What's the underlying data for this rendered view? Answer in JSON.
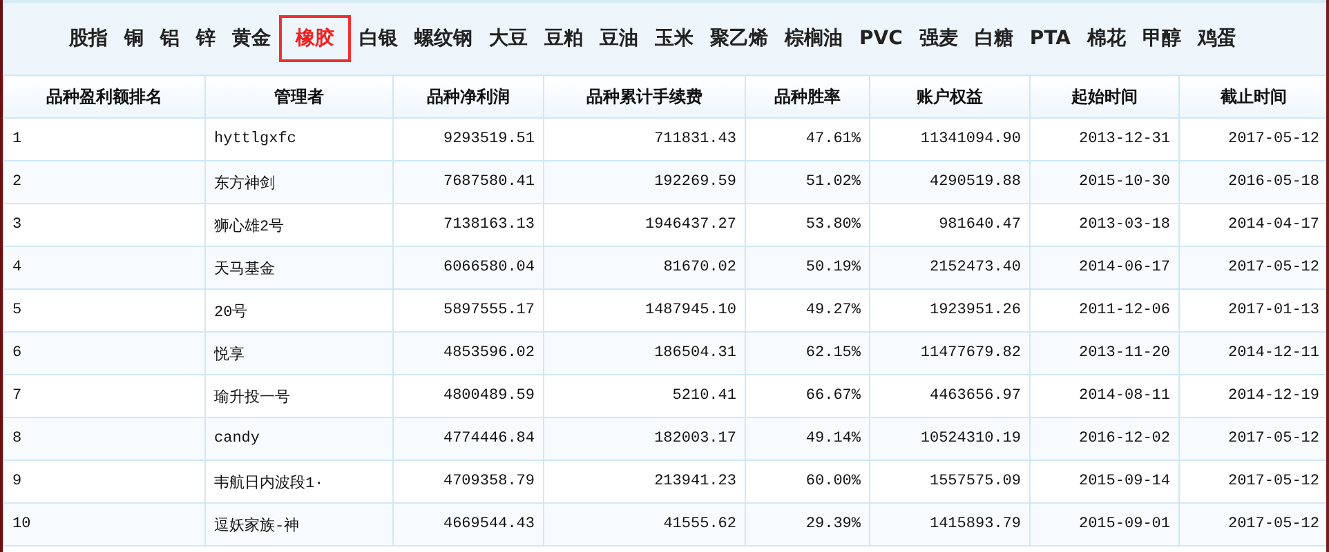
{
  "tabs": [
    {
      "label": "股指",
      "selected": false
    },
    {
      "label": "铜",
      "selected": false
    },
    {
      "label": "铝",
      "selected": false
    },
    {
      "label": "锌",
      "selected": false
    },
    {
      "label": "黄金",
      "selected": false
    },
    {
      "label": "橡胶",
      "selected": true
    },
    {
      "label": "白银",
      "selected": false
    },
    {
      "label": "螺纹钢",
      "selected": false
    },
    {
      "label": "大豆",
      "selected": false
    },
    {
      "label": "豆粕",
      "selected": false
    },
    {
      "label": "豆油",
      "selected": false
    },
    {
      "label": "玉米",
      "selected": false
    },
    {
      "label": "聚乙烯",
      "selected": false
    },
    {
      "label": "棕榈油",
      "selected": false
    },
    {
      "label": "PVC",
      "selected": false
    },
    {
      "label": "强麦",
      "selected": false
    },
    {
      "label": "白糖",
      "selected": false
    },
    {
      "label": "PTA",
      "selected": false
    },
    {
      "label": "棉花",
      "selected": false
    },
    {
      "label": "甲醇",
      "selected": false
    },
    {
      "label": "鸡蛋",
      "selected": false
    }
  ],
  "table": {
    "columns": [
      "品种盈利额排名",
      "管理者",
      "品种净利润",
      "品种累计手续费",
      "品种胜率",
      "账户权益",
      "起始时间",
      "截止时间"
    ],
    "rows": [
      [
        "1",
        "hyttlgxfc",
        "9293519.51",
        "711831.43",
        "47.61%",
        "11341094.90",
        "2013-12-31",
        "2017-05-12"
      ],
      [
        "2",
        "东方神剑",
        "7687580.41",
        "192269.59",
        "51.02%",
        "4290519.88",
        "2015-10-30",
        "2016-05-18"
      ],
      [
        "3",
        "狮心雄2号",
        "7138163.13",
        "1946437.27",
        "53.80%",
        "981640.47",
        "2013-03-18",
        "2014-04-17"
      ],
      [
        "4",
        "天马基金",
        "6066580.04",
        "81670.02",
        "50.19%",
        "2152473.40",
        "2014-06-17",
        "2017-05-12"
      ],
      [
        "5",
        "20号",
        "5897555.17",
        "1487945.10",
        "49.27%",
        "1923951.26",
        "2011-12-06",
        "2017-01-13"
      ],
      [
        "6",
        "悦享",
        "4853596.02",
        "186504.31",
        "62.15%",
        "11477679.82",
        "2013-11-20",
        "2014-12-11"
      ],
      [
        "7",
        "瑜升投一号",
        "4800489.59",
        "5210.41",
        "66.67%",
        "4463656.97",
        "2014-08-11",
        "2014-12-19"
      ],
      [
        "8",
        "candy",
        "4774446.84",
        "182003.17",
        "49.14%",
        "10524310.19",
        "2016-12-02",
        "2017-05-12"
      ],
      [
        "9",
        "韦航日内波段1·",
        "4709358.79",
        "213941.23",
        "60.00%",
        "1557575.09",
        "2015-09-14",
        "2017-05-12"
      ],
      [
        "10",
        "逗妖家族-神",
        "4669544.43",
        "41555.62",
        "29.39%",
        "1415893.79",
        "2015-09-01",
        "2017-05-12"
      ]
    ]
  }
}
